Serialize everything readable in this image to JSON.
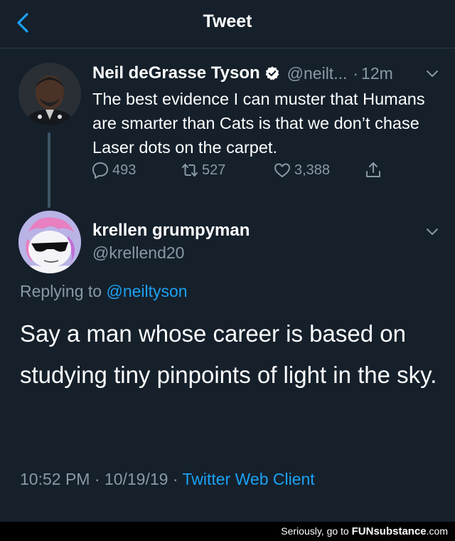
{
  "header": {
    "title": "Tweet",
    "back_icon": "chevron-left-icon",
    "accent": "#1da1f2"
  },
  "original_tweet": {
    "name": "Neil deGrasse Tyson",
    "verified_icon": "verified-badge-icon",
    "handle": "@neilt...",
    "separator": "·",
    "time": "12m",
    "text": "The best evidence I can muster that Humans are smarter than Cats is that we don’t chase Laser dots on the carpet.",
    "replies": "493",
    "retweets": "527",
    "likes": "3,388"
  },
  "reply_tweet": {
    "name": "krellen grumpyman",
    "handle": "@krellend20",
    "replying_prefix": "Replying to",
    "replying_to": "@neiltyson",
    "text": "Say a man whose career is based on studying tiny pinpoints of light in the sky.",
    "time": "10:52 PM",
    "date": "10/19/19",
    "separator": "·",
    "client": "Twitter Web Client"
  },
  "watermark": {
    "prefix": "Seriously, go to",
    "brand": "FUNsubstance",
    "suffix": ".com"
  },
  "colors": {
    "background": "#15202b",
    "secondary_text": "#8899a6",
    "link": "#1da1f2"
  }
}
